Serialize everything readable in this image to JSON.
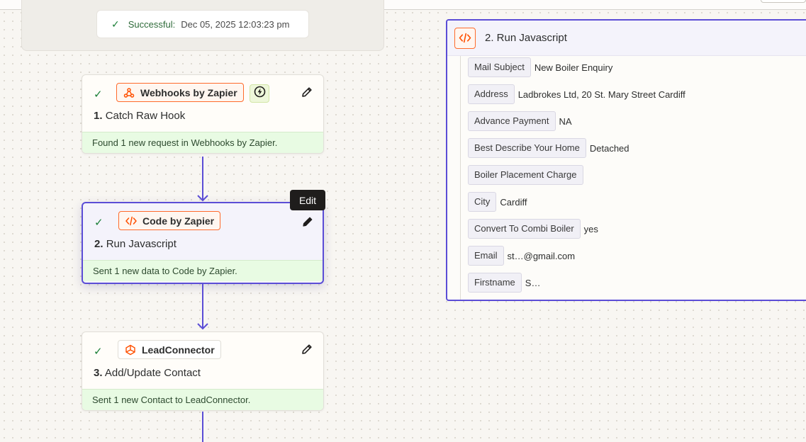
{
  "trigger_summary": {
    "status_label": "Successful:",
    "timestamp": "Dec 05, 2025 12:03:23 pm"
  },
  "steps": [
    {
      "app_name": "Webhooks by Zapier",
      "number": "1.",
      "title": "Catch Raw Hook",
      "status": "Found 1 new request in Webhooks by Zapier.",
      "icon": "webhook-icon",
      "has_instant_badge": true
    },
    {
      "app_name": "Code by Zapier",
      "number": "2.",
      "title": "Run Javascript",
      "status": "Sent 1 new data to Code by Zapier.",
      "icon": "code-icon",
      "selected": true
    },
    {
      "app_name": "LeadConnector",
      "number": "3.",
      "title": "Add/Update Contact",
      "status": "Sent 1 new Contact to LeadConnector.",
      "icon": "leadconnector-icon"
    }
  ],
  "tooltip": {
    "text": "Edit"
  },
  "detail_panel": {
    "title": "2. Run Javascript",
    "fields": [
      {
        "key": "Mail Subject",
        "value": "New Boiler Enquiry"
      },
      {
        "key": "Address",
        "value": "Ladbrokes Ltd, 20 St. Mary Street Cardiff"
      },
      {
        "key": "Advance Payment",
        "value": "NA"
      },
      {
        "key": "Best Describe Your Home",
        "value": "Detached"
      },
      {
        "key": "Boiler Placement Charge",
        "value": ""
      },
      {
        "key": "City",
        "value": "Cardiff"
      },
      {
        "key": "Convert To Combi Boiler",
        "value": "yes"
      },
      {
        "key": "Email",
        "value": "st…@gmail.com"
      },
      {
        "key": "Firstname",
        "value": "S…"
      }
    ]
  },
  "colors": {
    "accent": "#5b4dd6",
    "zapier_orange": "#ff6b2c",
    "success_green": "#1a7f37",
    "success_bg": "#e8fbe3"
  }
}
